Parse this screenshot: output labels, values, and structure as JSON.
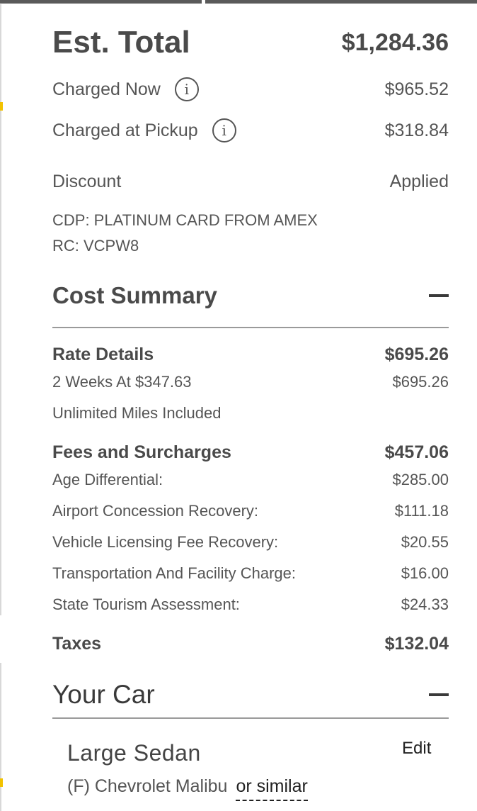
{
  "summary": {
    "est_total_label": "Est. Total",
    "est_total_value": "$1,284.36",
    "charged_now_label": "Charged Now",
    "charged_now_value": "$965.52",
    "charged_pickup_label": "Charged at Pickup",
    "charged_pickup_value": "$318.84",
    "info_glyph": "i",
    "discount_label": "Discount",
    "discount_value": "Applied",
    "cdp_text": "CDP: PLATINUM CARD FROM AMEX",
    "rc_text": "RC: VCPW8"
  },
  "cost_summary": {
    "title": "Cost Summary",
    "rate_details_label": "Rate Details",
    "rate_details_value": "$695.26",
    "rate_line_label": "2 Weeks At $347.63",
    "rate_line_value": "$695.26",
    "unlimited_miles": "Unlimited Miles Included",
    "fees_label": "Fees and Surcharges",
    "fees_value": "$457.06",
    "fees": [
      {
        "label": "Age Differential:",
        "value": "$285.00"
      },
      {
        "label": "Airport Concession Recovery:",
        "value": "$111.18"
      },
      {
        "label": "Vehicle Licensing Fee Recovery:",
        "value": "$20.55"
      },
      {
        "label": "Transportation And Facility Charge:",
        "value": "$16.00"
      },
      {
        "label": "State Tourism Assessment:",
        "value": "$24.33"
      }
    ],
    "taxes_label": "Taxes",
    "taxes_value": "$132.04"
  },
  "your_car": {
    "title": "Your Car",
    "car_class": "Large Sedan",
    "edit_label": "Edit",
    "model": "(F) Chevrolet Malibu",
    "or_similar": "or similar"
  },
  "icons": {
    "info": "info-circle-icon",
    "collapse": "minus-icon"
  },
  "colors": {
    "text_dark": "#4a4a4a",
    "text": "#555555",
    "divider": "#9a9a9a",
    "accent_tick": "#f2c200"
  }
}
